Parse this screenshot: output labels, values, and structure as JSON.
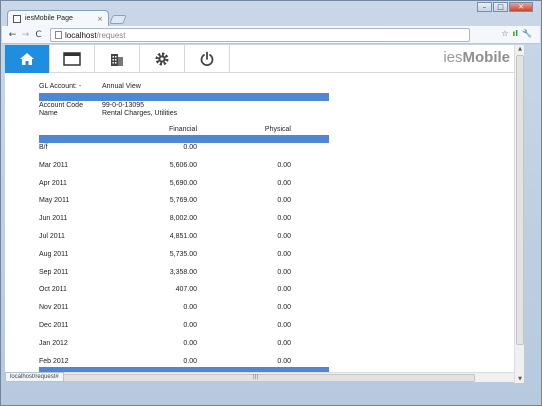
{
  "browser": {
    "tab_title": "iesMobile Page",
    "tab_close": "×",
    "url_host": "localhost",
    "url_path": "/request",
    "status_url": "localhost/request#",
    "controls": {
      "minimize": "–",
      "maximize": "□",
      "close": "✕"
    },
    "nav": {
      "back": "←",
      "forward": "→",
      "reload": "C"
    },
    "toolbar_icons": {
      "star": "☆",
      "signal": "ıl",
      "wrench": "🔧"
    }
  },
  "app": {
    "brand_plain": "ies",
    "brand_bold": "Mobile",
    "accent_color": "#1f8de0",
    "band_color": "#4f87d4",
    "nav_items": [
      "home-icon",
      "window-icon",
      "building-icon",
      "gear-icon",
      "power-icon"
    ]
  },
  "report": {
    "gl_label": "GL Account: -",
    "view": "Annual View",
    "account_code_label": "Account Code",
    "account_code": "99-0-0-13095",
    "name_label": "Name",
    "name": "Rental Charges, Utilities",
    "col_financial": "Financial",
    "col_physical": "Physical",
    "rows": [
      {
        "label": "B/f",
        "financial": "0.00",
        "physical": ""
      },
      {
        "label": "Mar 2011",
        "financial": "5,606.00",
        "physical": "0.00"
      },
      {
        "label": "Apr 2011",
        "financial": "5,690.00",
        "physical": "0.00"
      },
      {
        "label": "May 2011",
        "financial": "5,769.00",
        "physical": "0.00"
      },
      {
        "label": "Jun 2011",
        "financial": "8,002.00",
        "physical": "0.00"
      },
      {
        "label": "Jul 2011",
        "financial": "4,851.00",
        "physical": "0.00"
      },
      {
        "label": "Aug 2011",
        "financial": "5,735.00",
        "physical": "0.00"
      },
      {
        "label": "Sep 2011",
        "financial": "3,358.00",
        "physical": "0.00"
      },
      {
        "label": "Oct 2011",
        "financial": "407.00",
        "physical": "0.00"
      },
      {
        "label": "Nov 2011",
        "financial": "0.00",
        "physical": "0.00"
      },
      {
        "label": "Dec 2011",
        "financial": "0.00",
        "physical": "0.00"
      },
      {
        "label": "Jan 2012",
        "financial": "0.00",
        "physical": "0.00"
      },
      {
        "label": "Feb 2012",
        "financial": "0.00",
        "physical": "0.00"
      }
    ]
  }
}
